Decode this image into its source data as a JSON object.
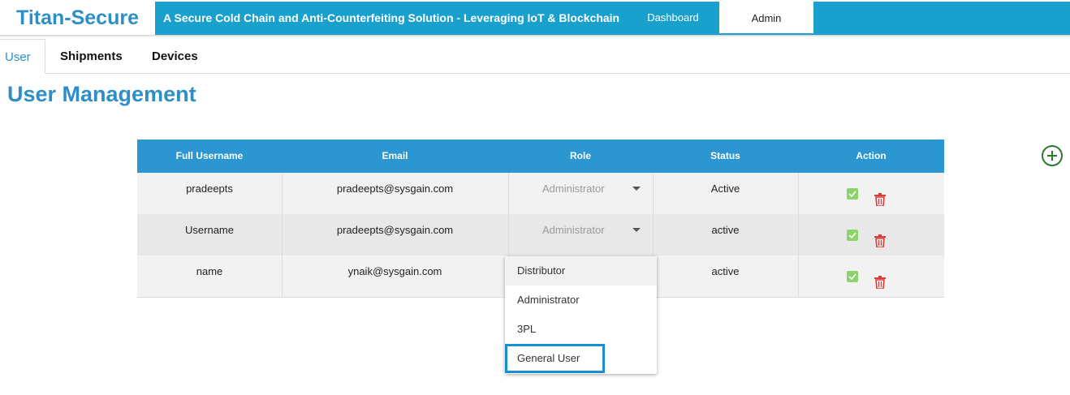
{
  "header": {
    "brand": "Titan-Secure",
    "app_title": "A Secure Cold Chain and Anti-Counterfeiting Solution - Leveraging IoT & Blockchain",
    "nav": {
      "dashboard": "Dashboard",
      "admin": "Admin"
    },
    "brand_color": "#2e8fc7",
    "bar_color": "#1aa0cd"
  },
  "tabs": [
    {
      "label": "User",
      "active": true
    },
    {
      "label": "Shipments",
      "active": false
    },
    {
      "label": "Devices",
      "active": false
    }
  ],
  "page_title": "User Management",
  "table": {
    "headers": [
      "Full Username",
      "Email",
      "Role",
      "Status",
      "Action"
    ],
    "rows": [
      {
        "username": "pradeepts",
        "email": "pradeepts@sysgain.com",
        "role": "Administrator",
        "status": "Active"
      },
      {
        "username": "Username",
        "email": "pradeepts@sysgain.com",
        "role": "Administrator",
        "status": "active"
      },
      {
        "username": "name",
        "email": "ynaik@sysgain.com",
        "role": "",
        "status": "active"
      }
    ]
  },
  "role_dropdown": {
    "options": [
      "Distributor",
      "Administrator",
      "3PL",
      "General User"
    ],
    "hovered": "Distributor",
    "focused": "General User"
  },
  "icons": {
    "add": "plus-circle-icon",
    "approve": "check-icon",
    "delete": "trash-icon"
  },
  "colors": {
    "check": "#8cd36b",
    "trash": "#d93b3b",
    "add": "#2d7a2d",
    "header_bg": "#2b96cf"
  }
}
